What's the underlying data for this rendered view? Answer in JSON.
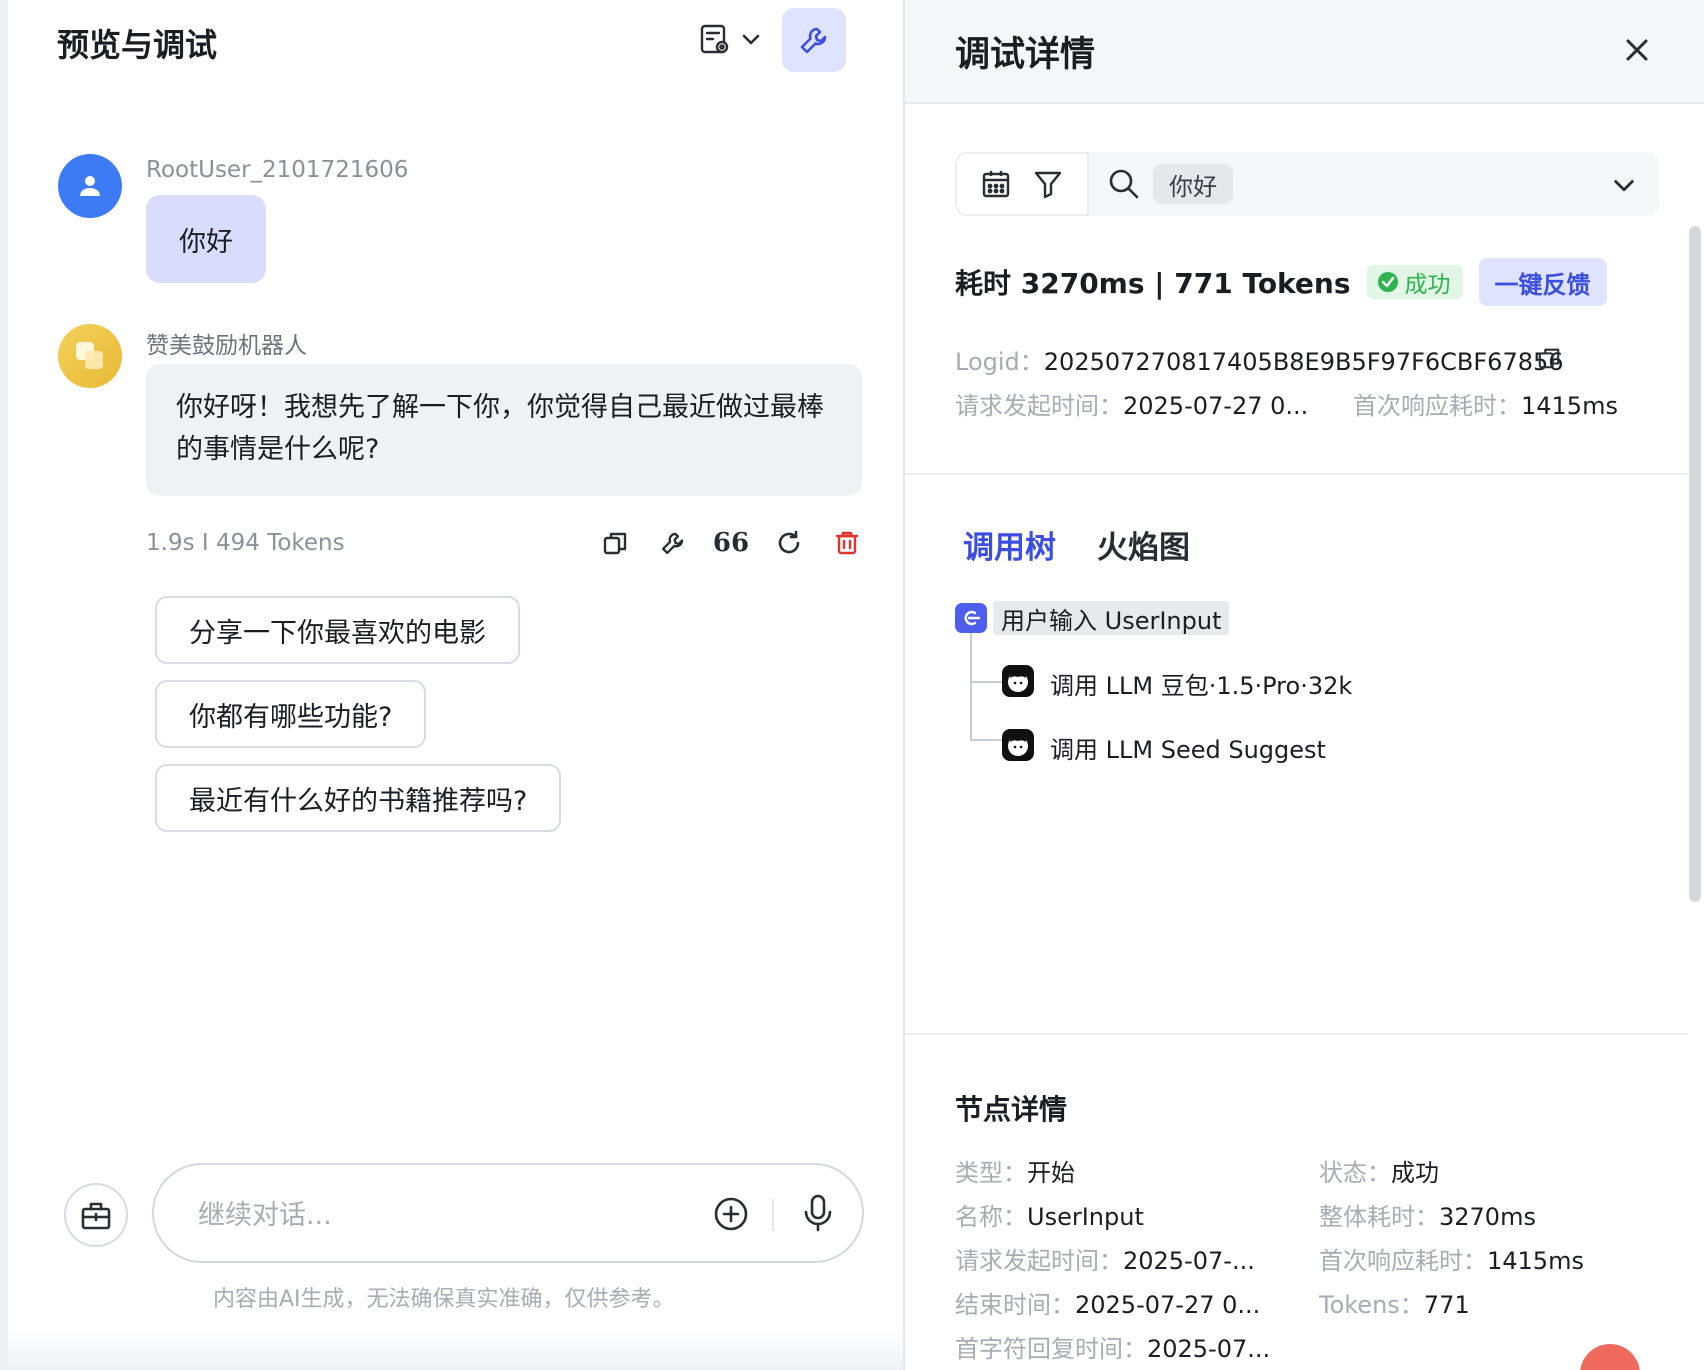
{
  "left": {
    "title": "预览与调试",
    "user_message": {
      "username": "RootUser_2101721606",
      "text": "你好"
    },
    "bot_message": {
      "botname": "赞美鼓励机器人",
      "text": "你好呀！我想先了解一下你，你觉得自己最近做过最棒的事情是什么呢?",
      "meta": "1.9s  I  494 Tokens",
      "quote_glyph": "66"
    },
    "suggestions": [
      "分享一下你最喜欢的电影",
      "你都有哪些功能?",
      "最近有什么好的书籍推荐吗?"
    ],
    "input": {
      "placeholder": "继续对话..."
    },
    "disclaimer": "内容由AI生成，无法确保真实准确，仅供参考。"
  },
  "right": {
    "title": "调试详情",
    "search_tag": "你好",
    "stat": "耗时 3270ms | 771 Tokens",
    "status_badge": "成功",
    "feedback_label": "一键反馈",
    "logid": {
      "label": "Logid：",
      "value": "202507270817405B8E9B5F97F6CBF67856"
    },
    "request_time": {
      "label": "请求发起时间：",
      "value": "2025-07-27 0..."
    },
    "first_response": {
      "label": "首次响应耗时：",
      "value": "1415ms"
    },
    "tabs": [
      "调用树",
      "火焰图"
    ],
    "tree": {
      "root": "用户输入 UserInput",
      "children": [
        "调用 LLM 豆包·1.5·Pro·32k",
        "调用 LLM Seed Suggest"
      ]
    },
    "node_details": {
      "title": "节点详情",
      "left": [
        {
          "label": "类型：",
          "value": "开始"
        },
        {
          "label": "名称：",
          "value": "UserInput"
        },
        {
          "label": "请求发起时间：",
          "value": "2025-07-..."
        },
        {
          "label": "结束时间：",
          "value": "2025-07-27 0..."
        },
        {
          "label": "首字符回复时间：",
          "value": "2025-07..."
        }
      ],
      "right": [
        {
          "label": "状态：",
          "value": "成功"
        },
        {
          "label": "整体耗时：",
          "value": "3270ms"
        },
        {
          "label": "首次响应耗时：",
          "value": "1415ms"
        },
        {
          "label": "Tokens：",
          "value": "771"
        }
      ]
    }
  },
  "colors": {
    "accent": "#3b4ee0",
    "accent_bg": "#dfe3ff",
    "user_avatar": "#3d7bf6",
    "success": "#2fb350",
    "delete": "#e5322d"
  },
  "icons": {
    "header": [
      "doc-settings-icon",
      "chevron-down-icon",
      "wrench-icon"
    ],
    "message_actions": [
      "copy-icon",
      "wrench-icon",
      "quote-icon",
      "refresh-icon",
      "trash-icon"
    ],
    "input": [
      "toolbox-icon",
      "plus-circle-icon",
      "mic-icon"
    ],
    "filter": [
      "calendar-icon",
      "filter-icon",
      "search-icon",
      "chevron-down-icon"
    ]
  }
}
